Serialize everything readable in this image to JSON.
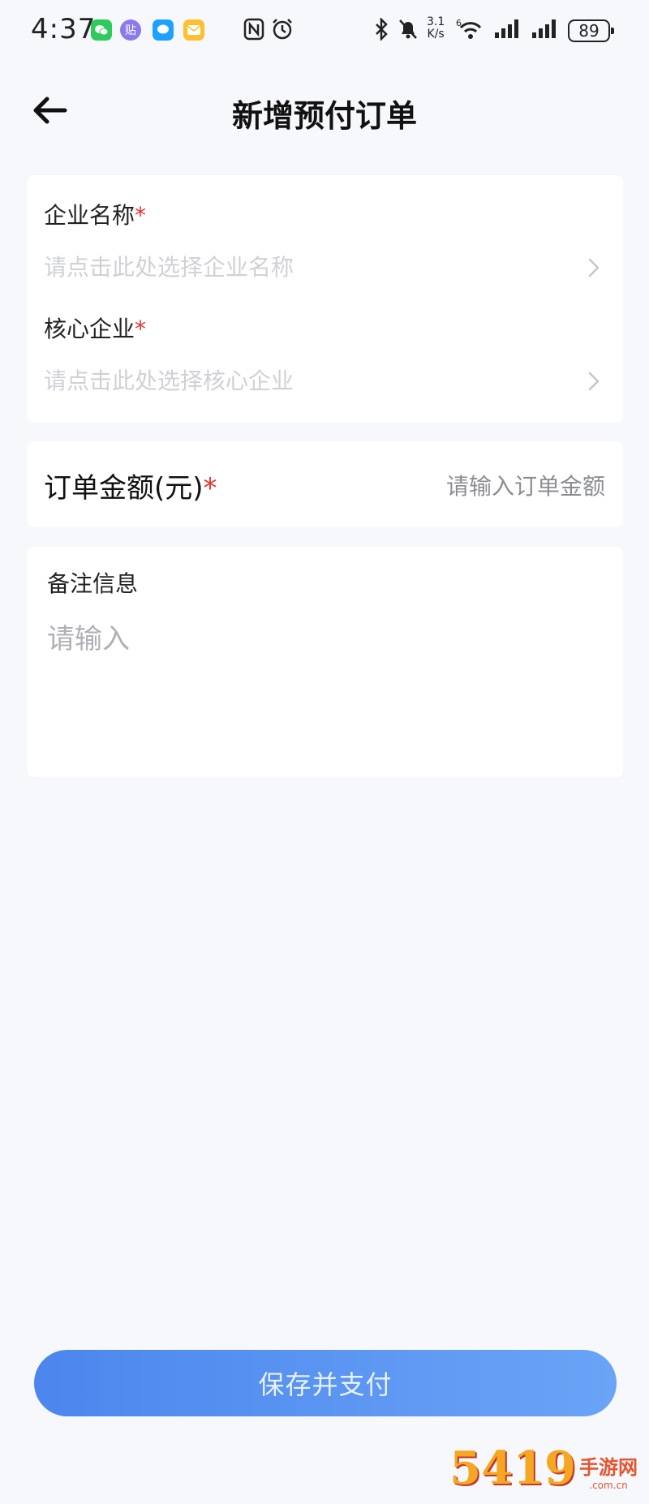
{
  "status_bar": {
    "time": "4:37",
    "app_icons": [
      "wechat-icon",
      "tieba-icon",
      "message-icon",
      "mail-icon"
    ],
    "apps": {
      "tieba_text": "贴"
    },
    "speed_value": "3.1",
    "speed_unit": "K/s",
    "network_gen": "6",
    "battery": "89"
  },
  "header": {
    "title": "新增预付订单",
    "back_icon": "arrow-left-icon"
  },
  "form": {
    "company": {
      "label": "企业名称",
      "required_mark": "*",
      "placeholder": "请点击此处选择企业名称"
    },
    "core_company": {
      "label": "核心企业",
      "required_mark": "*",
      "placeholder": "请点击此处选择核心企业"
    },
    "amount": {
      "label": "订单金额(元)",
      "required_mark": "*",
      "placeholder": "请输入订单金额"
    },
    "remark": {
      "label": "备注信息",
      "placeholder": "请输入"
    }
  },
  "actions": {
    "submit_label": "保存并支付"
  },
  "watermark": {
    "number": "5419",
    "cn_text": "手游网",
    "domain": ".com.cn"
  },
  "colors": {
    "background": "#f7f8fc",
    "required": "#e4342f",
    "button_start": "#4b86ee",
    "button_end": "#6aa4f6",
    "placeholder": "#cfd1d6"
  }
}
